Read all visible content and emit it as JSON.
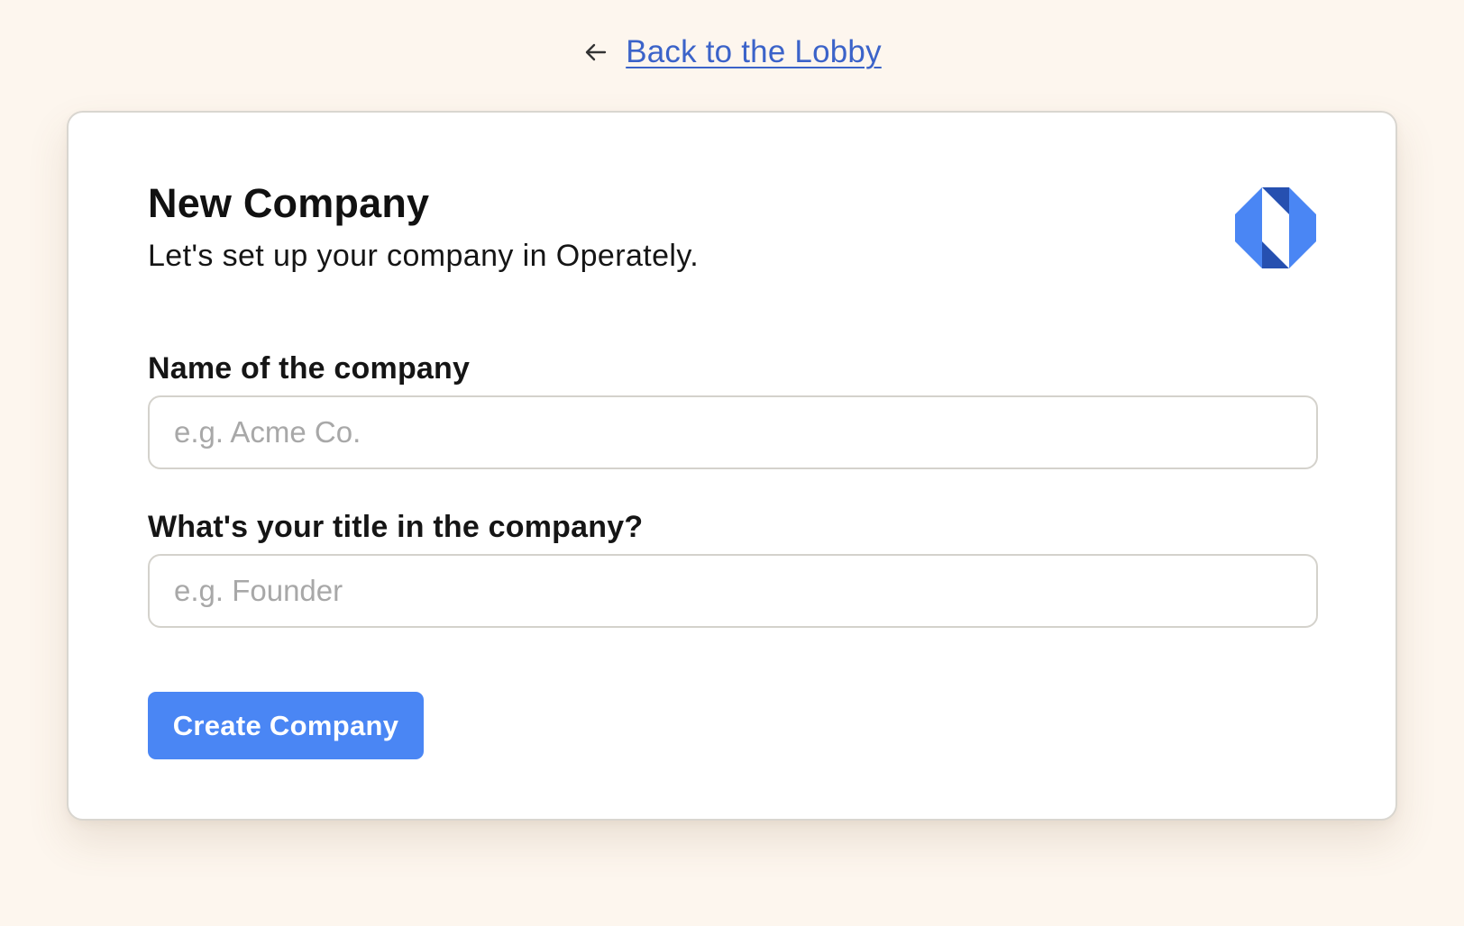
{
  "navigation": {
    "back_icon": "arrow-left-icon",
    "back_label": "Back to the Lobby"
  },
  "card": {
    "title": "New Company",
    "subtitle": "Let's set up your company in Operately.",
    "logo_icon": "operately-logo"
  },
  "form": {
    "company_name": {
      "label": "Name of the company",
      "value": "",
      "placeholder": "e.g. Acme Co."
    },
    "title": {
      "label": "What's your title in the company?",
      "value": "",
      "placeholder": "e.g. Founder"
    },
    "submit_label": "Create Company"
  },
  "colors": {
    "background": "#fdf6ee",
    "link": "#3b63c9",
    "primary_button": "#4a86f4",
    "logo_light": "#4a86f4",
    "logo_dark": "#2650b0"
  }
}
